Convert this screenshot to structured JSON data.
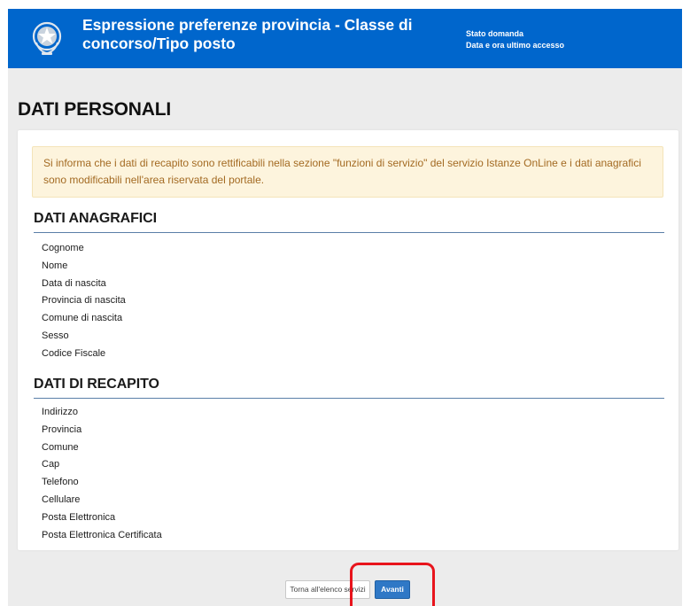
{
  "header": {
    "title": "Espressione preferenze provincia - Classe di concorso/Tipo posto",
    "status_label": "Stato domanda",
    "last_access_label": "Data e ora ultimo accesso",
    "emblem_icon": "italian-republic-emblem-icon",
    "background_color": "#0066cc"
  },
  "page": {
    "title": "DATI PERSONALI"
  },
  "notice": {
    "text": "Si informa che i dati di recapito sono rettificabili nella sezione \"funzioni di servizio\" del servizio Istanze OnLine e i dati anagrafici sono modificabili nell'area riservata del portale."
  },
  "anagrafici": {
    "title": "DATI ANAGRAFICI",
    "fields": [
      "Cognome",
      "Nome",
      "Data di nascita",
      "Provincia di nascita",
      "Comune di nascita",
      "Sesso",
      "Codice Fiscale"
    ]
  },
  "recapito": {
    "title": "DATI DI RECAPITO",
    "fields": [
      "Indirizzo",
      "Provincia",
      "Comune",
      "Cap",
      "Telefono",
      "Cellulare",
      "Posta Elettronica",
      "Posta Elettronica Certificata"
    ]
  },
  "actions": {
    "back_label": "Torna all'elenco servizi",
    "next_label": "Avanti",
    "highlight_color": "#e8141c"
  }
}
